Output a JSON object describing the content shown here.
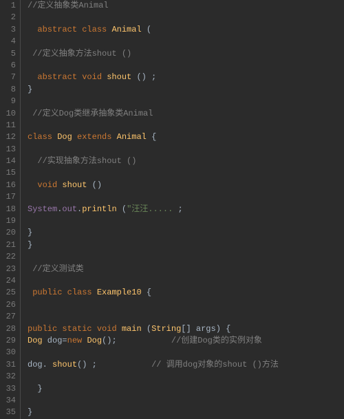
{
  "lines": [
    {
      "n": "1",
      "segs": [
        {
          "cls": "c-comment",
          "t": "//定义抽象类Animal"
        }
      ]
    },
    {
      "n": "2",
      "segs": []
    },
    {
      "n": "3",
      "segs": [
        {
          "cls": "",
          "t": "  "
        },
        {
          "cls": "c-keyword",
          "t": "abstract"
        },
        {
          "cls": "",
          "t": " "
        },
        {
          "cls": "c-keyword",
          "t": "class"
        },
        {
          "cls": "",
          "t": " "
        },
        {
          "cls": "c-type",
          "t": "Animal"
        },
        {
          "cls": "",
          "t": " ("
        }
      ]
    },
    {
      "n": "4",
      "segs": []
    },
    {
      "n": "5",
      "segs": [
        {
          "cls": "",
          "t": " "
        },
        {
          "cls": "c-comment",
          "t": "//定义抽象方法shout ()"
        }
      ]
    },
    {
      "n": "6",
      "segs": []
    },
    {
      "n": "7",
      "segs": [
        {
          "cls": "",
          "t": "  "
        },
        {
          "cls": "c-keyword",
          "t": "abstract"
        },
        {
          "cls": "",
          "t": " "
        },
        {
          "cls": "c-keyword",
          "t": "void"
        },
        {
          "cls": "",
          "t": " "
        },
        {
          "cls": "c-type",
          "t": "shout"
        },
        {
          "cls": "",
          "t": " () ;"
        }
      ]
    },
    {
      "n": "8",
      "segs": [
        {
          "cls": "",
          "t": "}"
        }
      ]
    },
    {
      "n": "9",
      "segs": []
    },
    {
      "n": "10",
      "segs": [
        {
          "cls": "",
          "t": " "
        },
        {
          "cls": "c-comment",
          "t": "//定义Dog类继承抽象类Animal"
        }
      ]
    },
    {
      "n": "11",
      "segs": []
    },
    {
      "n": "12",
      "segs": [
        {
          "cls": "c-keyword",
          "t": "class"
        },
        {
          "cls": "",
          "t": " "
        },
        {
          "cls": "c-type",
          "t": "Dog"
        },
        {
          "cls": "",
          "t": " "
        },
        {
          "cls": "c-keyword",
          "t": "extends"
        },
        {
          "cls": "",
          "t": " "
        },
        {
          "cls": "c-type",
          "t": "Animal"
        },
        {
          "cls": "",
          "t": " {"
        }
      ]
    },
    {
      "n": "13",
      "segs": []
    },
    {
      "n": "14",
      "segs": [
        {
          "cls": "",
          "t": "  "
        },
        {
          "cls": "c-comment",
          "t": "//实现抽象方法shout ()"
        }
      ]
    },
    {
      "n": "15",
      "segs": []
    },
    {
      "n": "16",
      "segs": [
        {
          "cls": "",
          "t": "  "
        },
        {
          "cls": "c-keyword",
          "t": "void"
        },
        {
          "cls": "",
          "t": " "
        },
        {
          "cls": "c-type",
          "t": "shout"
        },
        {
          "cls": "",
          "t": " ()"
        }
      ]
    },
    {
      "n": "17",
      "segs": []
    },
    {
      "n": "18",
      "segs": [
        {
          "cls": "c-builtin",
          "t": "System"
        },
        {
          "cls": "",
          "t": "."
        },
        {
          "cls": "c-builtin",
          "t": "out"
        },
        {
          "cls": "",
          "t": "."
        },
        {
          "cls": "c-type",
          "t": "println"
        },
        {
          "cls": "",
          "t": " ("
        },
        {
          "cls": "c-string",
          "t": "\"汪汪....."
        },
        {
          "cls": "",
          "t": " ;"
        }
      ]
    },
    {
      "n": "19",
      "segs": []
    },
    {
      "n": "20",
      "segs": [
        {
          "cls": "",
          "t": "}"
        }
      ]
    },
    {
      "n": "21",
      "segs": [
        {
          "cls": "",
          "t": "}"
        }
      ]
    },
    {
      "n": "22",
      "segs": []
    },
    {
      "n": "23",
      "segs": [
        {
          "cls": "",
          "t": " "
        },
        {
          "cls": "c-comment",
          "t": "//定义测试类"
        }
      ]
    },
    {
      "n": "24",
      "segs": []
    },
    {
      "n": "25",
      "segs": [
        {
          "cls": "",
          "t": " "
        },
        {
          "cls": "c-keyword",
          "t": "public"
        },
        {
          "cls": "",
          "t": " "
        },
        {
          "cls": "c-keyword",
          "t": "class"
        },
        {
          "cls": "",
          "t": " "
        },
        {
          "cls": "c-type",
          "t": "Example10"
        },
        {
          "cls": "",
          "t": " {"
        }
      ]
    },
    {
      "n": "26",
      "segs": []
    },
    {
      "n": "27",
      "segs": []
    },
    {
      "n": "28",
      "segs": [
        {
          "cls": "c-keyword",
          "t": "public"
        },
        {
          "cls": "",
          "t": " "
        },
        {
          "cls": "c-keyword",
          "t": "static"
        },
        {
          "cls": "",
          "t": " "
        },
        {
          "cls": "c-keyword",
          "t": "void"
        },
        {
          "cls": "",
          "t": " "
        },
        {
          "cls": "c-type",
          "t": "main"
        },
        {
          "cls": "",
          "t": " ("
        },
        {
          "cls": "c-type",
          "t": "String"
        },
        {
          "cls": "",
          "t": "[] args) {"
        }
      ]
    },
    {
      "n": "29",
      "segs": [
        {
          "cls": "c-type",
          "t": "Dog"
        },
        {
          "cls": "",
          "t": " dog="
        },
        {
          "cls": "c-keyword",
          "t": "new"
        },
        {
          "cls": "",
          "t": " "
        },
        {
          "cls": "c-type",
          "t": "Dog"
        },
        {
          "cls": "",
          "t": "();           "
        },
        {
          "cls": "c-comment",
          "t": "//创建Dog类的实例对象"
        }
      ]
    },
    {
      "n": "30",
      "segs": []
    },
    {
      "n": "31",
      "segs": [
        {
          "cls": "",
          "t": "dog. "
        },
        {
          "cls": "c-type",
          "t": "shout"
        },
        {
          "cls": "",
          "t": "() ;           "
        },
        {
          "cls": "c-comment",
          "t": "// 调用dog对象的shout ()方法"
        }
      ]
    },
    {
      "n": "32",
      "segs": []
    },
    {
      "n": "33",
      "segs": [
        {
          "cls": "",
          "t": "  }"
        }
      ]
    },
    {
      "n": "34",
      "segs": []
    },
    {
      "n": "35",
      "segs": [
        {
          "cls": "",
          "t": "}"
        }
      ]
    }
  ]
}
